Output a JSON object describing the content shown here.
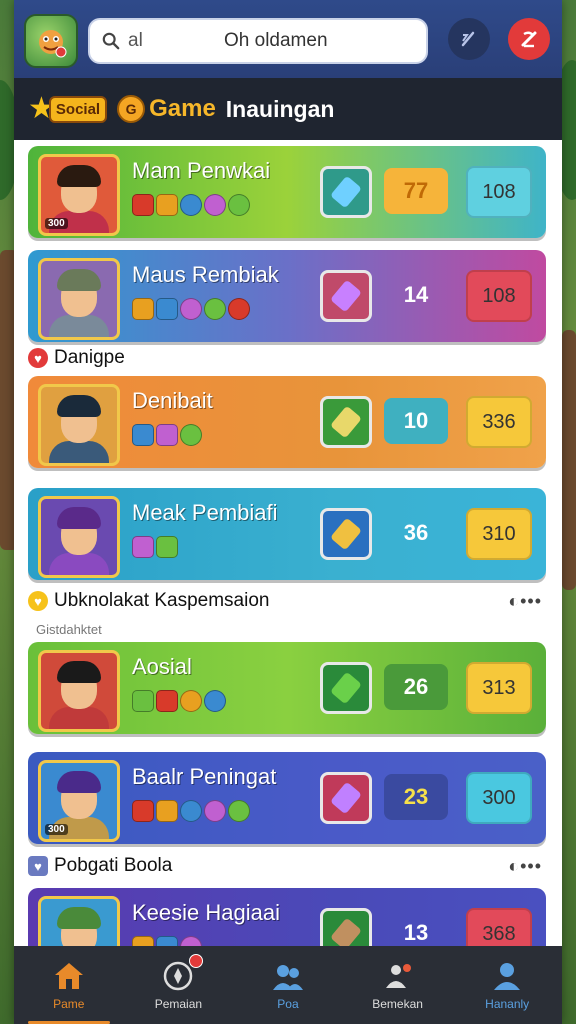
{
  "search": {
    "placeholder": "al",
    "value": "Oh oldamen"
  },
  "header": {
    "social": "Social",
    "game": "Game",
    "title": "Inauingan"
  },
  "cards": [
    {
      "name": "Mam Penwkai",
      "score": "77",
      "reward": "108",
      "bg": "linear-gradient(90deg,#4fb43b,#9bd23a 50%,#3fb4c8)",
      "score_bg": "#f6b43a",
      "score_color": "#c06a06",
      "reward_bg": "#5fd0e0",
      "item_bg": "#2f9a8a",
      "item_color": "#6fd0ff",
      "avatar_bg": "#e05a3a",
      "hair": "#2a1a10",
      "shirt": "#c0304a",
      "tag": "300"
    },
    {
      "name": "Maus Rembiak",
      "score": "14",
      "reward": "108",
      "bg": "linear-gradient(90deg,#2f9ad0,#6a70c8 50%,#c04aa0)",
      "score_bg": "transparent",
      "score_color": "#ffffff",
      "reward_bg": "#e24a5a",
      "item_bg": "#c04a6a",
      "item_color": "#c880ff",
      "avatar_bg": "#8a6ab0",
      "hair": "#6a7a5a",
      "shirt": "#7a8a9a",
      "tag": ""
    },
    {
      "name": "Denibait",
      "score": "10",
      "reward": "336",
      "bg": "linear-gradient(90deg,#f08a3a,#e8943a 60%,#f0a24a)",
      "score_bg": "#3fb0c0",
      "score_color": "#ffffff",
      "reward_bg": "#f6c83a",
      "item_bg": "#3a9a3a",
      "item_color": "#e8d86a",
      "avatar_bg": "#e0a040",
      "hair": "#1a2a3a",
      "shirt": "#3a5a7a",
      "tag": ""
    },
    {
      "name": "Meak Pembiafi",
      "score": "36",
      "reward": "310",
      "bg": "linear-gradient(90deg,#2aa0c8,#3ab0d0 60%,#3ab4d8)",
      "score_bg": "transparent",
      "score_color": "#ffffff",
      "reward_bg": "#f6c83a",
      "item_bg": "#2a70c0",
      "item_color": "#f0c040",
      "avatar_bg": "#6a4ab0",
      "hair": "#5a2a8a",
      "shirt": "#8a4ac0",
      "tag": ""
    },
    {
      "name": "Aosial",
      "score": "26",
      "reward": "313",
      "bg": "linear-gradient(90deg,#6ac03a,#8ad040 50%,#5ab03a)",
      "score_bg": "#4a9a3a",
      "score_color": "#ffffff",
      "reward_bg": "#f6c83a",
      "item_bg": "#2a8a3a",
      "item_color": "#6ad04a",
      "avatar_bg": "#d04a3a",
      "hair": "#1a1a1a",
      "shirt": "#c03a3a",
      "tag": ""
    },
    {
      "name": "Baalr Peningat",
      "score": "23",
      "reward": "300",
      "bg": "linear-gradient(90deg,#3a5ac0,#4a5ac8 60%,#4a60c8)",
      "score_bg": "#3a4aa0",
      "score_color": "#f6e04a",
      "reward_bg": "#4ac8e0",
      "item_bg": "#c03a5a",
      "item_color": "#c080ff",
      "avatar_bg": "#3a8ad0",
      "hair": "#4a2a8a",
      "shirt": "#c09a4a",
      "tag": "300"
    },
    {
      "name": "Keesie Hagiaai",
      "score": "13",
      "reward": "368",
      "bg": "linear-gradient(90deg,#5a3ab0,#4a4ab8 60%,#4a50c0)",
      "score_bg": "transparent",
      "score_color": "#ffffff",
      "reward_bg": "#e24a5a",
      "item_bg": "#2a8a3a",
      "item_color": "#c09060",
      "avatar_bg": "#3a9ad0",
      "hair": "#4a8a3a",
      "shirt": "#4a6ac0",
      "tag": ""
    }
  ],
  "sections": [
    {
      "label": "Danigpe",
      "icon_color": "#e23a3a"
    },
    {
      "label": "Ubknolakat Kaspemsaion",
      "icon_color": "#f6c21a"
    },
    {
      "label": "Pobgati Boola",
      "icon_color": "#6a7ac0"
    }
  ],
  "sublabel": "Gistdahktet",
  "nav": [
    {
      "label": "Pame",
      "color": "#e88a2a",
      "active": true
    },
    {
      "label": "Pemaian",
      "color": "#dddddd",
      "active": false
    },
    {
      "label": "Poa",
      "color": "#5aa0e0",
      "active": false
    },
    {
      "label": "Bemekan",
      "color": "#dddddd",
      "active": false
    },
    {
      "label": "Hananly",
      "color": "#5aa0e0",
      "active": false
    }
  ],
  "gem_colors": [
    "#d83a2a",
    "#e8a020",
    "#3a8ad0",
    "#c060d0",
    "#6ac040"
  ]
}
